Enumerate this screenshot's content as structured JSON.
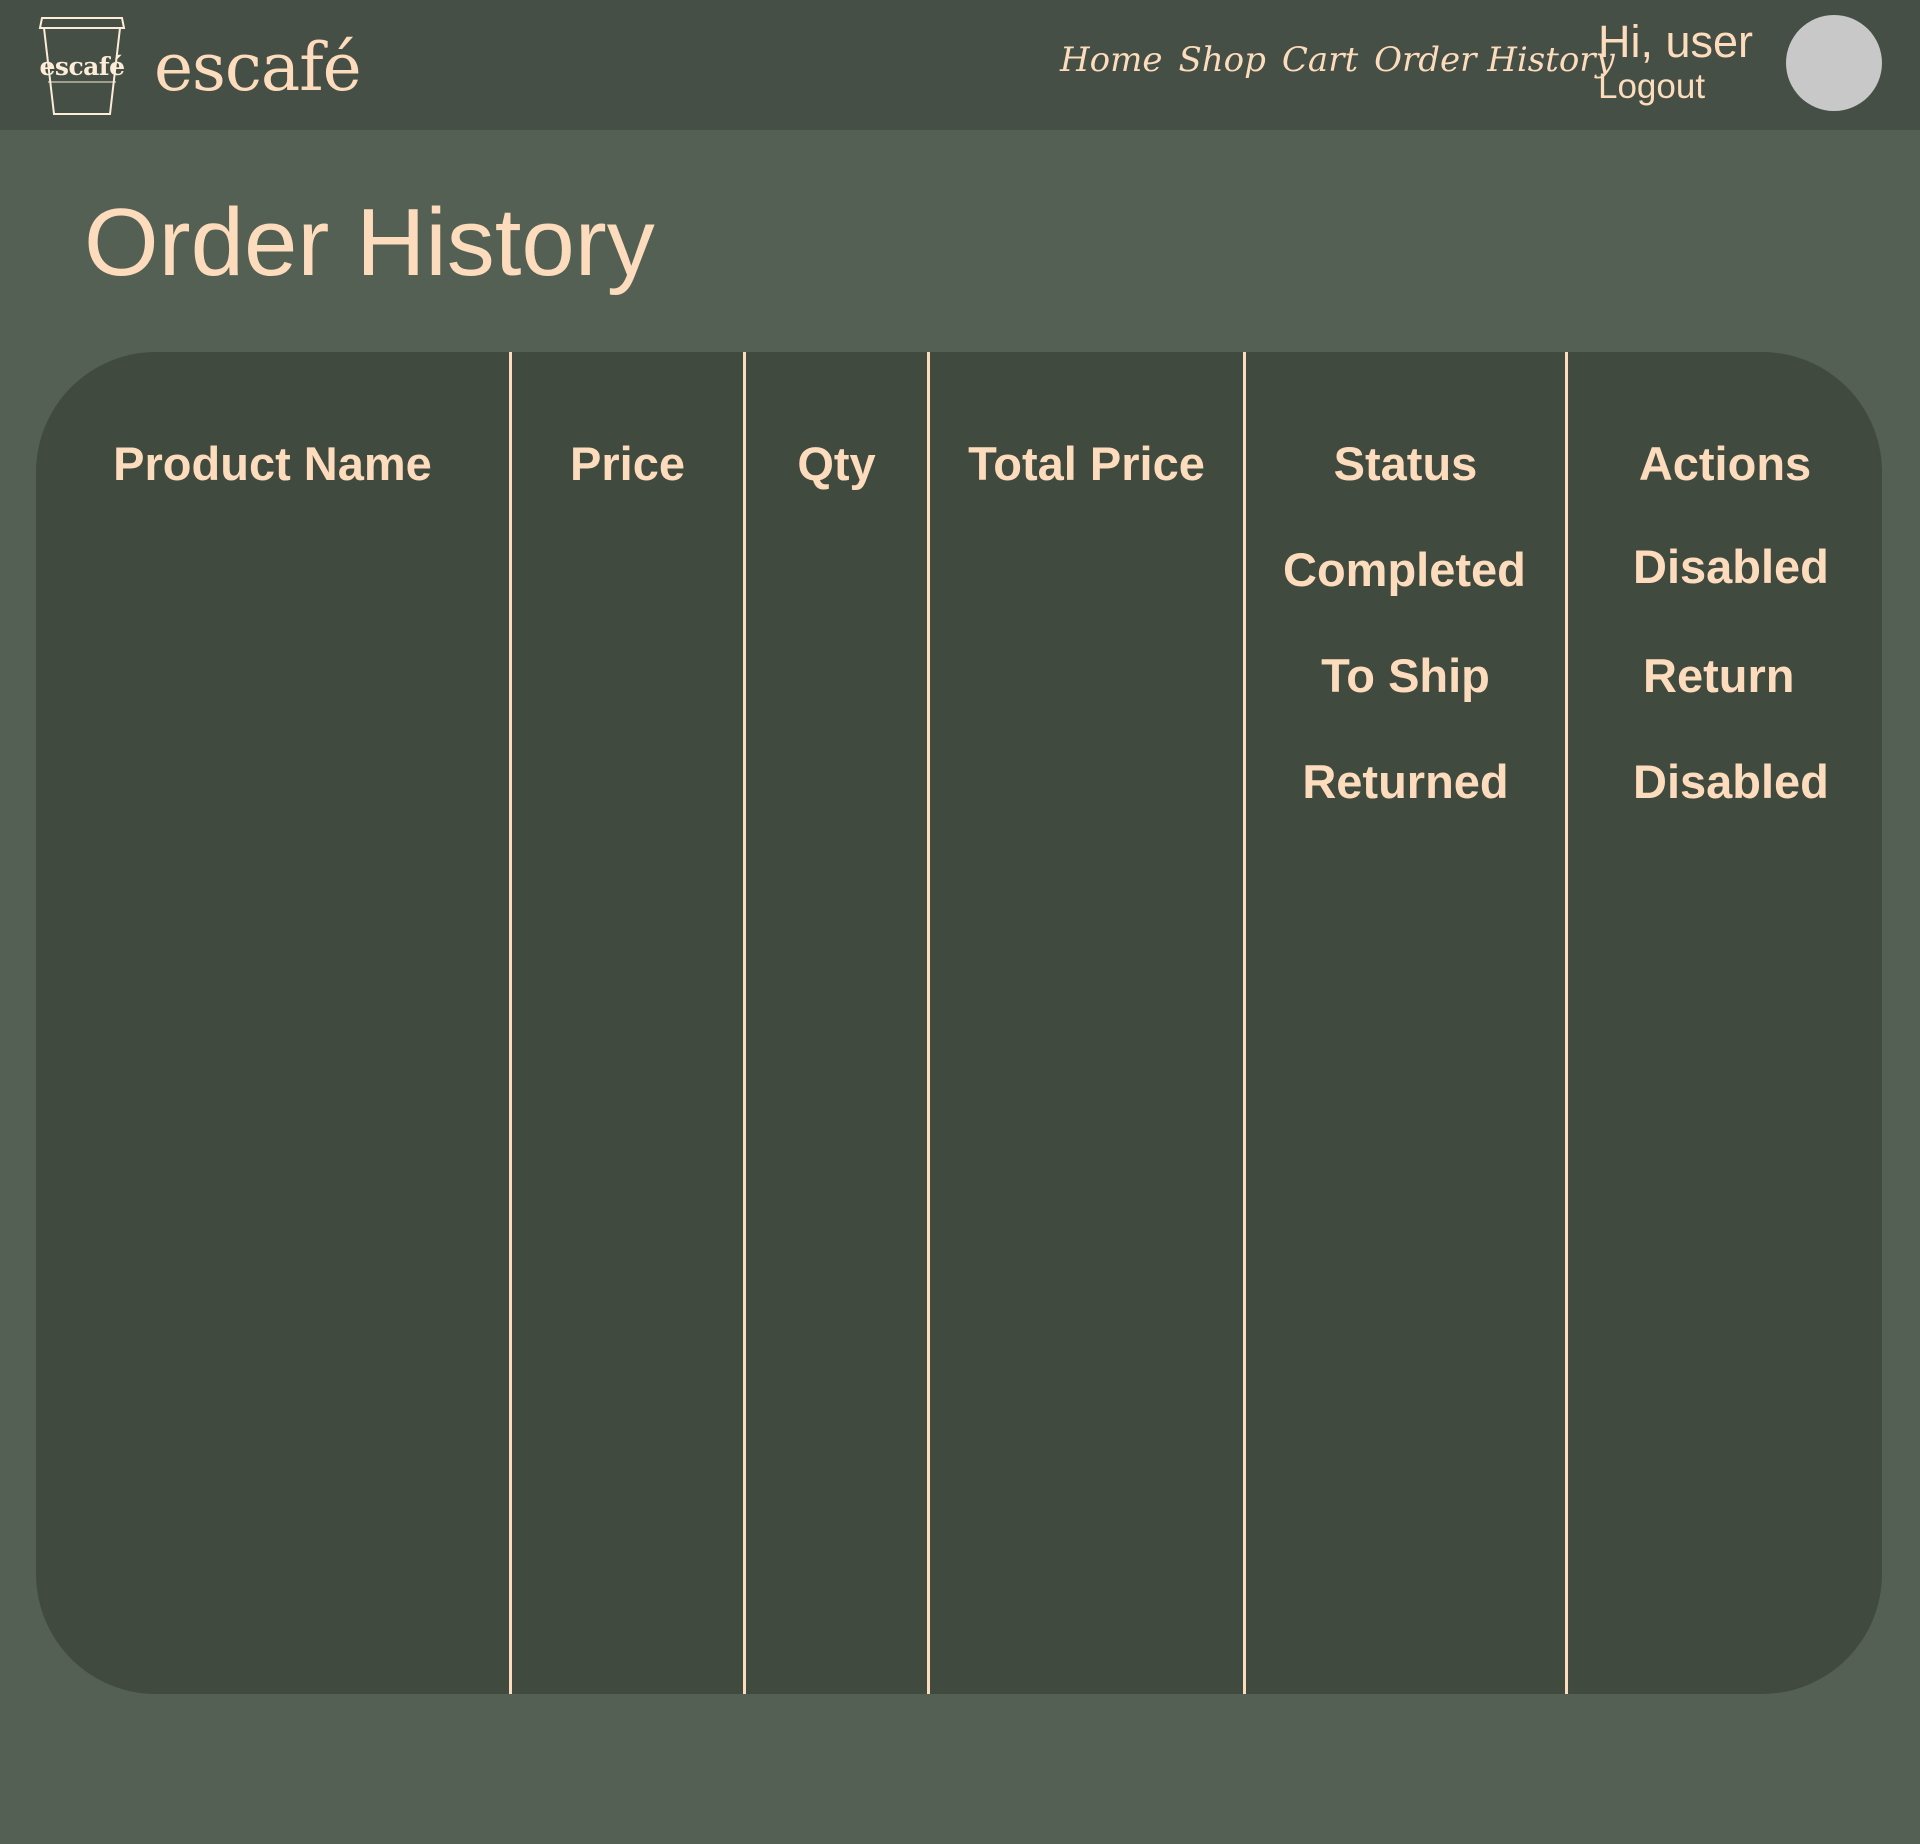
{
  "brand": {
    "logo_word": "escafé",
    "name": "escafé"
  },
  "nav": {
    "items": [
      "Home",
      "Shop",
      "Cart",
      "Order History"
    ]
  },
  "user": {
    "greeting": "Hi, user",
    "logout": "Logout"
  },
  "page": {
    "title": "Order History"
  },
  "table": {
    "headers": [
      "Product Name",
      "Price",
      "Qty",
      "Total Price",
      "Status",
      "Actions"
    ],
    "rows": [
      {
        "status": "Completed",
        "action": "Disabled"
      },
      {
        "status": "To Ship",
        "action": "Return"
      },
      {
        "status": "Returned",
        "action": "Disabled"
      }
    ]
  },
  "colors": {
    "page_bg": "#546053",
    "header_bg": "#454f45",
    "card_bg": "#414a3f",
    "accent_text": "#fcdcbc",
    "avatar": "#c8c8c8"
  }
}
